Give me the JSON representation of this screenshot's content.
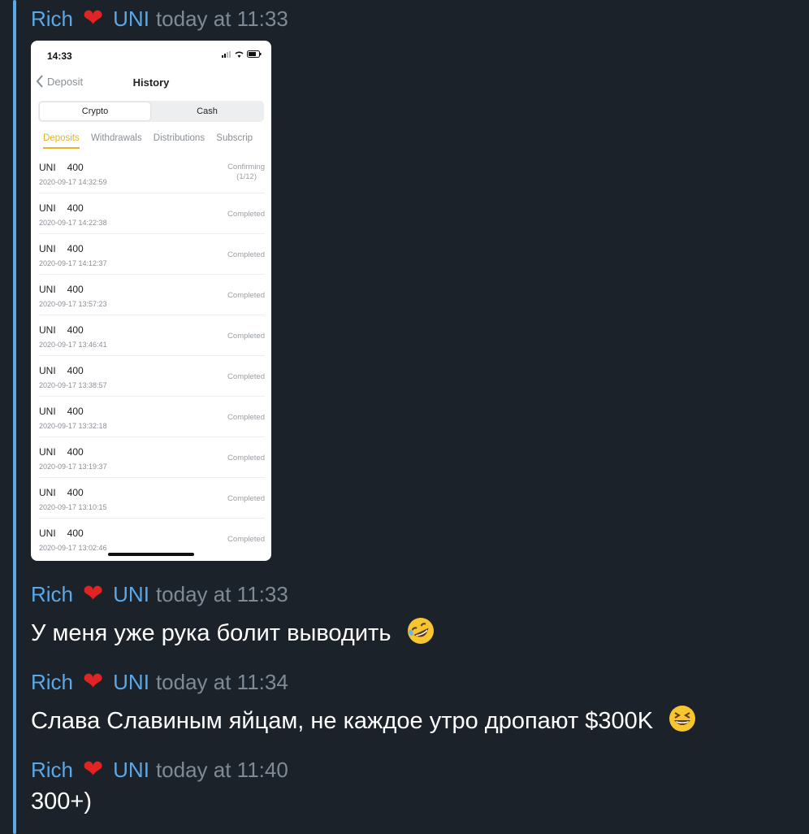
{
  "messages": [
    {
      "sender": "Rich",
      "heart": "❤",
      "tag": "UNI",
      "time": "today at 11:33"
    },
    {
      "sender": "Rich",
      "heart": "❤",
      "tag": "UNI",
      "time": "today at 11:33",
      "text": "У меня уже рука болит выводить",
      "emoji": "rolling-on-floor-laughing"
    },
    {
      "sender": "Rich",
      "heart": "❤",
      "tag": "UNI",
      "time": "today at 11:34",
      "text": "Слава Славиным яйцам, не каждое утро дропают $300K",
      "emoji": "grinning-squinting"
    },
    {
      "sender": "Rich",
      "heart": "❤",
      "tag": "UNI",
      "time": "today at 11:40",
      "text": "300+)"
    }
  ],
  "phone": {
    "clock": "14:33",
    "back_label": "Deposit",
    "title": "History",
    "segments": [
      "Crypto",
      "Cash"
    ],
    "tabs": [
      "Deposits",
      "Withdrawals",
      "Distributions",
      "Subscrip"
    ],
    "rows": [
      {
        "coin": "UNI",
        "amount": "400",
        "date": "2020-09-17 14:32:59",
        "status": "Confirming",
        "status2": "(1/12)"
      },
      {
        "coin": "UNI",
        "amount": "400",
        "date": "2020-09-17 14:22:38",
        "status": "Completed"
      },
      {
        "coin": "UNI",
        "amount": "400",
        "date": "2020-09-17 14:12:37",
        "status": "Completed"
      },
      {
        "coin": "UNI",
        "amount": "400",
        "date": "2020-09-17 13:57:23",
        "status": "Completed"
      },
      {
        "coin": "UNI",
        "amount": "400",
        "date": "2020-09-17 13:46:41",
        "status": "Completed"
      },
      {
        "coin": "UNI",
        "amount": "400",
        "date": "2020-09-17 13:38:57",
        "status": "Completed"
      },
      {
        "coin": "UNI",
        "amount": "400",
        "date": "2020-09-17 13:32:18",
        "status": "Completed"
      },
      {
        "coin": "UNI",
        "amount": "400",
        "date": "2020-09-17 13:19:37",
        "status": "Completed"
      },
      {
        "coin": "UNI",
        "amount": "400",
        "date": "2020-09-17 13:10:15",
        "status": "Completed"
      },
      {
        "coin": "UNI",
        "amount": "400",
        "date": "2020-09-17 13:02:46",
        "status": "Completed"
      }
    ]
  },
  "colors": {
    "background": "#1b222a",
    "name": "#5aa8e8",
    "time": "#7e8a96",
    "heart": "#e02424",
    "active_tab": "#e8b220"
  }
}
